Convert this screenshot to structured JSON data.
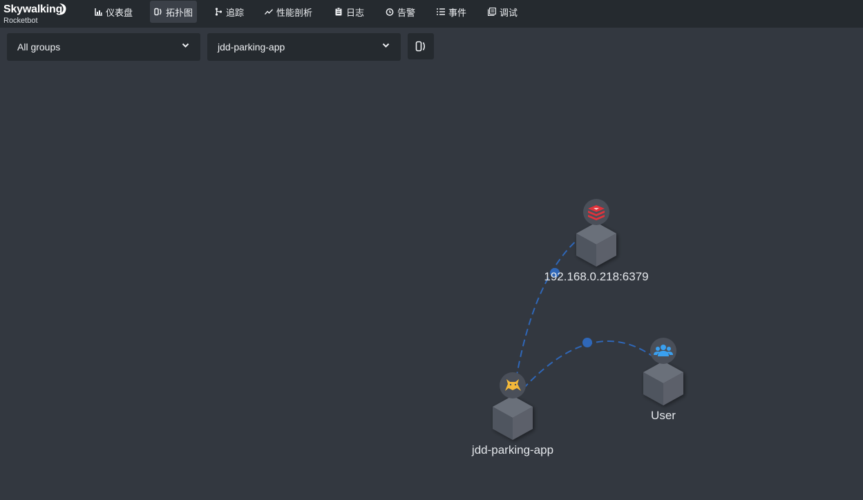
{
  "brand": {
    "title": "Skywalking",
    "subtitle": "Rocketbot"
  },
  "nav": {
    "items": [
      {
        "label": "仪表盘",
        "icon": "dashboard-chart-icon",
        "active": false
      },
      {
        "label": "拓扑图",
        "icon": "topology-icon",
        "active": true
      },
      {
        "label": "追踪",
        "icon": "trace-icon",
        "active": false
      },
      {
        "label": "性能剖析",
        "icon": "profile-trend-icon",
        "active": false
      },
      {
        "label": "日志",
        "icon": "log-clipboard-icon",
        "active": false
      },
      {
        "label": "告警",
        "icon": "alarm-clock-icon",
        "active": false
      },
      {
        "label": "事件",
        "icon": "event-list-icon",
        "active": false
      },
      {
        "label": "调试",
        "icon": "debug-icon",
        "active": false
      }
    ]
  },
  "toolbar": {
    "group_select": "All groups",
    "service_select": "jdd-parking-app",
    "switch_icon": "topology-switch-icon"
  },
  "topology": {
    "nodes": [
      {
        "label": "192.168.0.218:6379",
        "type": "redis-icon"
      },
      {
        "label": "User",
        "type": "user-group-icon"
      },
      {
        "label": "jdd-parking-app",
        "type": "tomcat-icon"
      }
    ]
  },
  "colors": {
    "background": "#333840",
    "navbar": "#252a2f",
    "link": "#2f67b8",
    "redis": "#e0323b",
    "user": "#3aa0f0",
    "tomcat": "#f4b93a"
  }
}
